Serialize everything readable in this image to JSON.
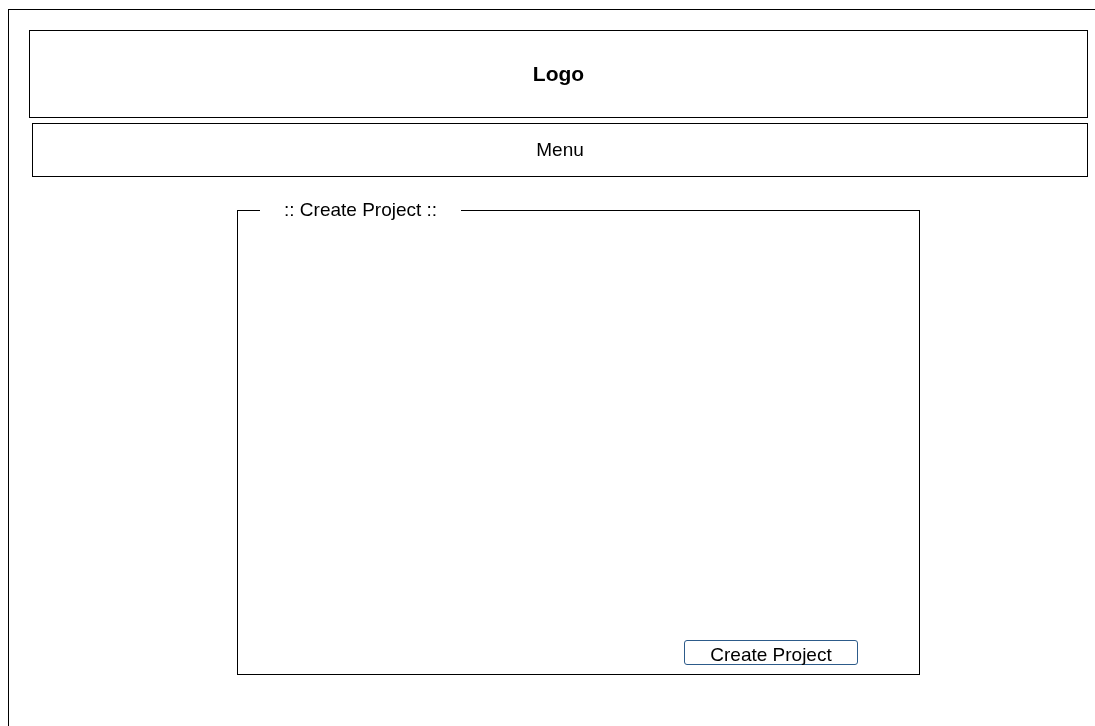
{
  "header": {
    "logo": "Logo"
  },
  "menu": {
    "label": "Menu"
  },
  "form": {
    "legend": ":: Create Project ::",
    "submit_button": "Create Project"
  }
}
